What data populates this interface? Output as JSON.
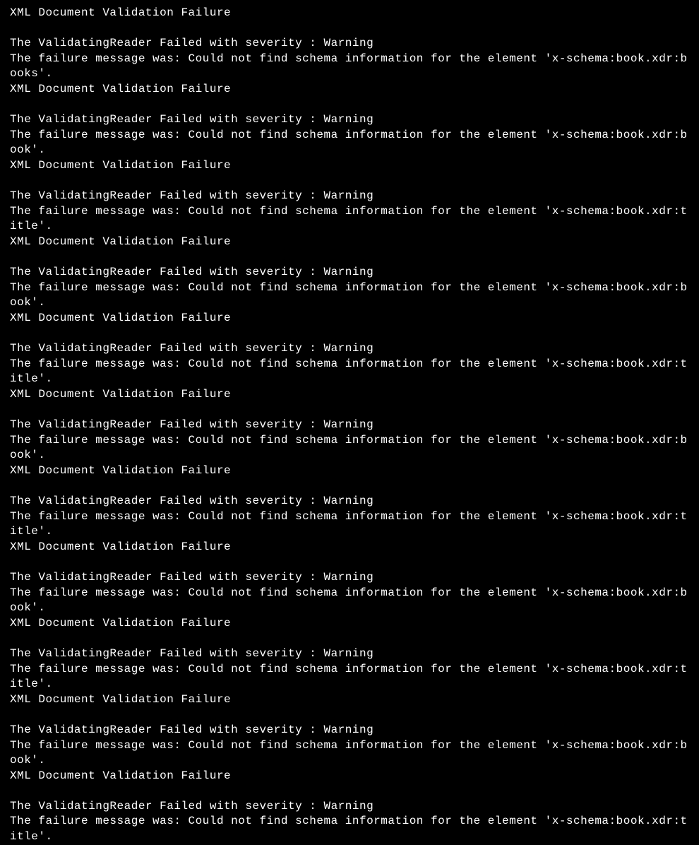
{
  "console": {
    "header": "XML Document Validation Failure",
    "blank": "",
    "severity_line": "The ValidatingReader Failed with severity : Warning",
    "msg_prefix": "The failure message was: Could not find schema information for the element 'x-schema:book.xdr:",
    "msg_suffix": "'.",
    "entries": [
      {
        "element": "books",
        "trailing_header": true
      },
      {
        "element": "book",
        "trailing_header": true
      },
      {
        "element": "title",
        "trailing_header": true
      },
      {
        "element": "book",
        "trailing_header": true
      },
      {
        "element": "title",
        "trailing_header": true
      },
      {
        "element": "book",
        "trailing_header": true
      },
      {
        "element": "title",
        "trailing_header": true
      },
      {
        "element": "book",
        "trailing_header": true
      },
      {
        "element": "title",
        "trailing_header": true
      },
      {
        "element": "book",
        "trailing_header": true
      },
      {
        "element": "title",
        "trailing_header": false
      }
    ]
  }
}
